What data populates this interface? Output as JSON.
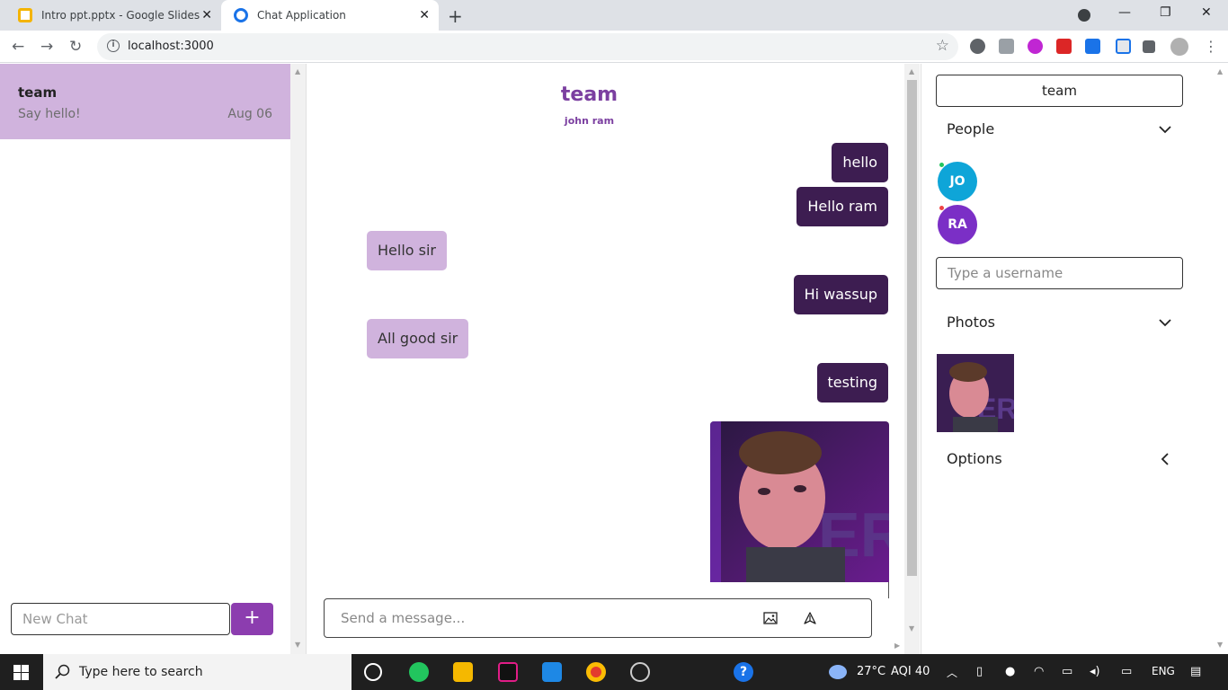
{
  "browser": {
    "tabs": [
      {
        "title": "Intro ppt.pptx - Google Slides"
      },
      {
        "title": "Chat Application"
      }
    ],
    "url": "localhost:3000"
  },
  "sidebar": {
    "chats": [
      {
        "title": "team",
        "last_message": "Say hello!",
        "date": "Aug 06"
      }
    ],
    "new_chat_placeholder": "New Chat",
    "new_chat_button": "+"
  },
  "chat": {
    "title": "team",
    "subtitle": "john ram",
    "messages": [
      {
        "text": "hello",
        "mine": true
      },
      {
        "text": "Hello ram",
        "mine": true
      },
      {
        "text": "Hello sir",
        "mine": false
      },
      {
        "text": "Hi wassup",
        "mine": true
      },
      {
        "text": "All good sir",
        "mine": false
      },
      {
        "text": "testing",
        "mine": true
      }
    ],
    "composer_placeholder": "Send a message..."
  },
  "settings": {
    "chat_title": "team",
    "sections": {
      "people": "People",
      "photos": "Photos",
      "options": "Options"
    },
    "people": [
      {
        "initials": "JO",
        "color": "#0ea5d8",
        "presence": "#22c55e"
      },
      {
        "initials": "RA",
        "color": "#7b2fc6",
        "presence": "#ef4444"
      }
    ],
    "username_placeholder": "Type a username"
  },
  "taskbar": {
    "search_placeholder": "Type here to search",
    "weather": "27°C",
    "aqi": "AQI 40",
    "language": "ENG"
  },
  "colors": {
    "accent": "#8c3daf",
    "mine_bubble": "#3d1d51",
    "theirs_bubble": "#d0b3dd"
  }
}
